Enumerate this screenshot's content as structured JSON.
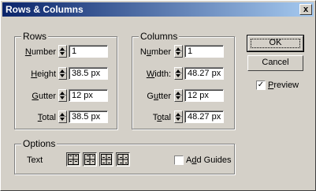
{
  "window": {
    "title": "Rows & Columns",
    "close_glyph": "x"
  },
  "rows": {
    "legend": "Rows",
    "number": {
      "label_pre": "",
      "label_key": "N",
      "label_post": "umber",
      "value": "1"
    },
    "height": {
      "label_pre": "",
      "label_key": "H",
      "label_post": "eight",
      "value": "38.5 px"
    },
    "gutter": {
      "label_pre": "",
      "label_key": "G",
      "label_post": "utter",
      "value": "12 px"
    },
    "total": {
      "label_pre": "",
      "label_key": "T",
      "label_post": "otal",
      "value": "38.5 px"
    }
  },
  "columns": {
    "legend": "Columns",
    "number": {
      "label_pre": "N",
      "label_key": "u",
      "label_post": "mber",
      "value": "1"
    },
    "width": {
      "label_pre": "",
      "label_key": "W",
      "label_post": "idth:",
      "value": "48.27 px"
    },
    "gutter": {
      "label_pre": "G",
      "label_key": "u",
      "label_post": "tter",
      "value": "12 px"
    },
    "total": {
      "label_pre": "T",
      "label_key": "o",
      "label_post": "tal",
      "value": "48.27 px"
    }
  },
  "options": {
    "legend": "Options",
    "text_label": "Text",
    "add_guides": {
      "label_pre": "A",
      "label_key": "d",
      "label_post": "d Guides",
      "checked": false
    }
  },
  "buttons": {
    "ok": "OK",
    "cancel": "Cancel"
  },
  "preview": {
    "label_pre": "",
    "label_key": "P",
    "label_post": "review",
    "checked": true,
    "check_glyph": "✓"
  }
}
